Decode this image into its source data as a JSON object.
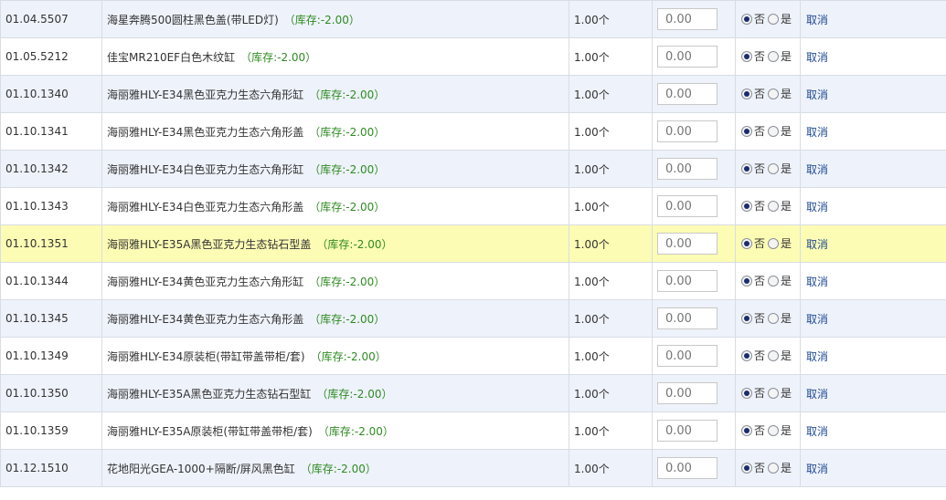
{
  "rows": [
    {
      "code": "01.04.5507",
      "name": "海星奔腾500圆柱黑色盖(带LED灯)",
      "stock": "（库存:-2.00）",
      "qty": "1.00个",
      "price_placeholder": "0.00",
      "option_no": "否",
      "option_yes": "是",
      "action": "取消",
      "selected": "no"
    },
    {
      "code": "01.05.5212",
      "name": "佳宝MR210EF白色木纹缸",
      "stock": "（库存:-2.00）",
      "qty": "1.00个",
      "price_placeholder": "0.00",
      "option_no": "否",
      "option_yes": "是",
      "action": "取消",
      "selected": "no"
    },
    {
      "code": "01.10.1340",
      "name": "海丽雅HLY-E34黑色亚克力生态六角形缸",
      "stock": "（库存:-2.00）",
      "qty": "1.00个",
      "price_placeholder": "0.00",
      "option_no": "否",
      "option_yes": "是",
      "action": "取消",
      "selected": "no"
    },
    {
      "code": "01.10.1341",
      "name": "海丽雅HLY-E34黑色亚克力生态六角形盖",
      "stock": "（库存:-2.00）",
      "qty": "1.00个",
      "price_placeholder": "0.00",
      "option_no": "否",
      "option_yes": "是",
      "action": "取消",
      "selected": "no"
    },
    {
      "code": "01.10.1342",
      "name": "海丽雅HLY-E34白色亚克力生态六角形缸",
      "stock": "（库存:-2.00）",
      "qty": "1.00个",
      "price_placeholder": "0.00",
      "option_no": "否",
      "option_yes": "是",
      "action": "取消",
      "selected": "no"
    },
    {
      "code": "01.10.1343",
      "name": "海丽雅HLY-E34白色亚克力生态六角形盖",
      "stock": "（库存:-2.00）",
      "qty": "1.00个",
      "price_placeholder": "0.00",
      "option_no": "否",
      "option_yes": "是",
      "action": "取消",
      "selected": "no"
    },
    {
      "code": "01.10.1351",
      "name": "海丽雅HLY-E35A黑色亚克力生态钻石型盖",
      "stock": "（库存:-2.00）",
      "qty": "1.00个",
      "price_placeholder": "0.00",
      "option_no": "否",
      "option_yes": "是",
      "action": "取消",
      "selected": "no",
      "highlighted": true
    },
    {
      "code": "01.10.1344",
      "name": "海丽雅HLY-E34黄色亚克力生态六角形缸",
      "stock": "（库存:-2.00）",
      "qty": "1.00个",
      "price_placeholder": "0.00",
      "option_no": "否",
      "option_yes": "是",
      "action": "取消",
      "selected": "no"
    },
    {
      "code": "01.10.1345",
      "name": "海丽雅HLY-E34黄色亚克力生态六角形盖",
      "stock": "（库存:-2.00）",
      "qty": "1.00个",
      "price_placeholder": "0.00",
      "option_no": "否",
      "option_yes": "是",
      "action": "取消",
      "selected": "no"
    },
    {
      "code": "01.10.1349",
      "name": "海丽雅HLY-E34原装柜(带缸带盖带柜/套)",
      "stock": "（库存:-2.00）",
      "qty": "1.00个",
      "price_placeholder": "0.00",
      "option_no": "否",
      "option_yes": "是",
      "action": "取消",
      "selected": "no"
    },
    {
      "code": "01.10.1350",
      "name": "海丽雅HLY-E35A黑色亚克力生态钻石型缸",
      "stock": "（库存:-2.00）",
      "qty": "1.00个",
      "price_placeholder": "0.00",
      "option_no": "否",
      "option_yes": "是",
      "action": "取消",
      "selected": "no"
    },
    {
      "code": "01.10.1359",
      "name": "海丽雅HLY-E35A原装柜(带缸带盖带柜/套)",
      "stock": "（库存:-2.00）",
      "qty": "1.00个",
      "price_placeholder": "0.00",
      "option_no": "否",
      "option_yes": "是",
      "action": "取消",
      "selected": "no"
    },
    {
      "code": "01.12.1510",
      "name": "花地阳光GEA-1000+隔断/屏风黑色缸",
      "stock": "（库存:-2.00）",
      "qty": "1.00个",
      "price_placeholder": "0.00",
      "option_no": "否",
      "option_yes": "是",
      "action": "取消",
      "selected": "no"
    }
  ],
  "colors": {
    "stock_text": "#2e8b22",
    "row_alt_bg": "#eef2fa",
    "row_highlight_bg": "#fcfcb4",
    "link": "#1f4a94",
    "border": "#d8dde4"
  }
}
